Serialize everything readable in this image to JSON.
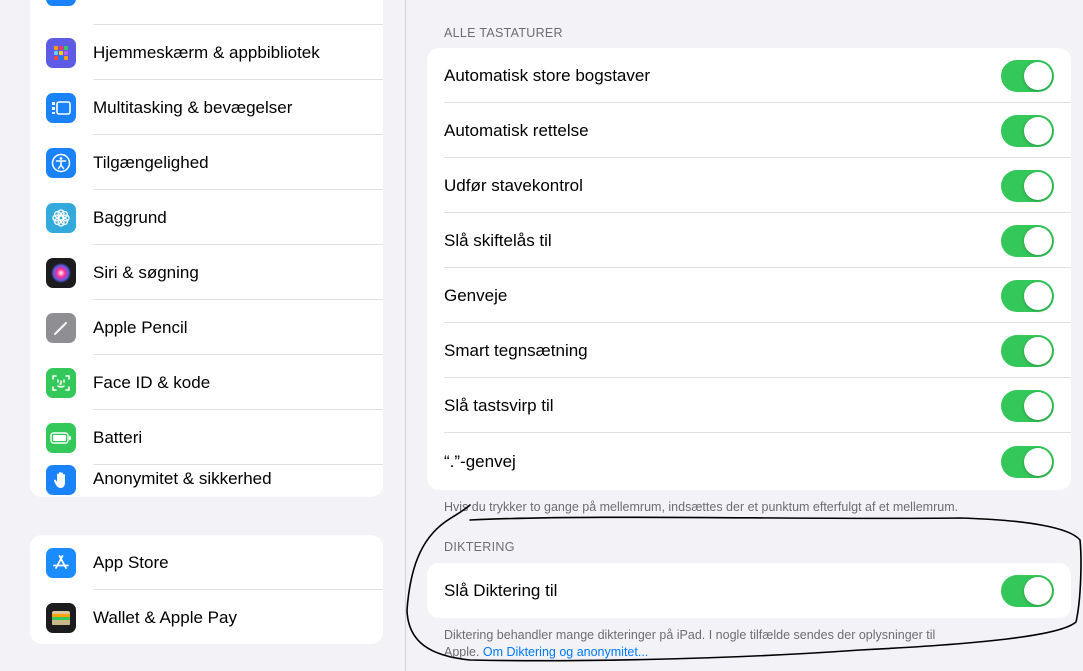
{
  "sidebar": {
    "group1": [
      {
        "label": "Hjemmeskærm & appbibliotek",
        "icon": "home-screen-icon",
        "color": "#5e5ce6"
      },
      {
        "label": "Multitasking & bevægelser",
        "icon": "multitasking-icon",
        "color": "#1a82fb"
      },
      {
        "label": "Tilgængelighed",
        "icon": "accessibility-icon",
        "color": "#1a82fb"
      },
      {
        "label": "Baggrund",
        "icon": "wallpaper-icon",
        "color": "#34aadc"
      },
      {
        "label": "Siri & søgning",
        "icon": "siri-icon",
        "color": "#222222"
      },
      {
        "label": "Apple Pencil",
        "icon": "pencil-icon",
        "color": "#8e8e93"
      },
      {
        "label": "Face ID & kode",
        "icon": "face-id-icon",
        "color": "#34c759"
      },
      {
        "label": "Batteri",
        "icon": "battery-icon",
        "color": "#34c759"
      },
      {
        "label": "Anonymitet & sikkerhed",
        "icon": "hand-icon",
        "color": "#1a82fb"
      }
    ],
    "group2": [
      {
        "label": "App Store",
        "icon": "app-store-icon",
        "color": "#1a8cff"
      },
      {
        "label": "Wallet & Apple Pay",
        "icon": "wallet-icon",
        "color": "#1c1c1e"
      }
    ]
  },
  "main": {
    "keyboards_header": "ALLE TASTATURER",
    "keyboard_options": [
      {
        "label": "Automatisk store bogstaver",
        "on": true
      },
      {
        "label": "Automatisk rettelse",
        "on": true
      },
      {
        "label": "Udfør stavekontrol",
        "on": true
      },
      {
        "label": "Slå skiftelås til",
        "on": true
      },
      {
        "label": "Genveje",
        "on": true
      },
      {
        "label": "Smart tegnsætning",
        "on": true
      },
      {
        "label": "Slå tastsvirp til",
        "on": true
      },
      {
        "label": "“.”-genvej",
        "on": true
      }
    ],
    "keyboards_footer": "Hvis du trykker to gange på mellemrum, indsættes der et punktum efterfulgt af et mellemrum.",
    "dictation_header": "DIKTERING",
    "dictation_option": {
      "label": "Slå Diktering til",
      "on": true
    },
    "dictation_footer_line1": "Diktering behandler mange dikteringer på iPad. I nogle tilfælde sendes der oplysninger til",
    "dictation_footer_prefix": "Apple. ",
    "dictation_footer_link": "Om Diktering og anonymitet..."
  },
  "colors": {
    "toggle_on": "#34c759",
    "link": "#007aff"
  }
}
